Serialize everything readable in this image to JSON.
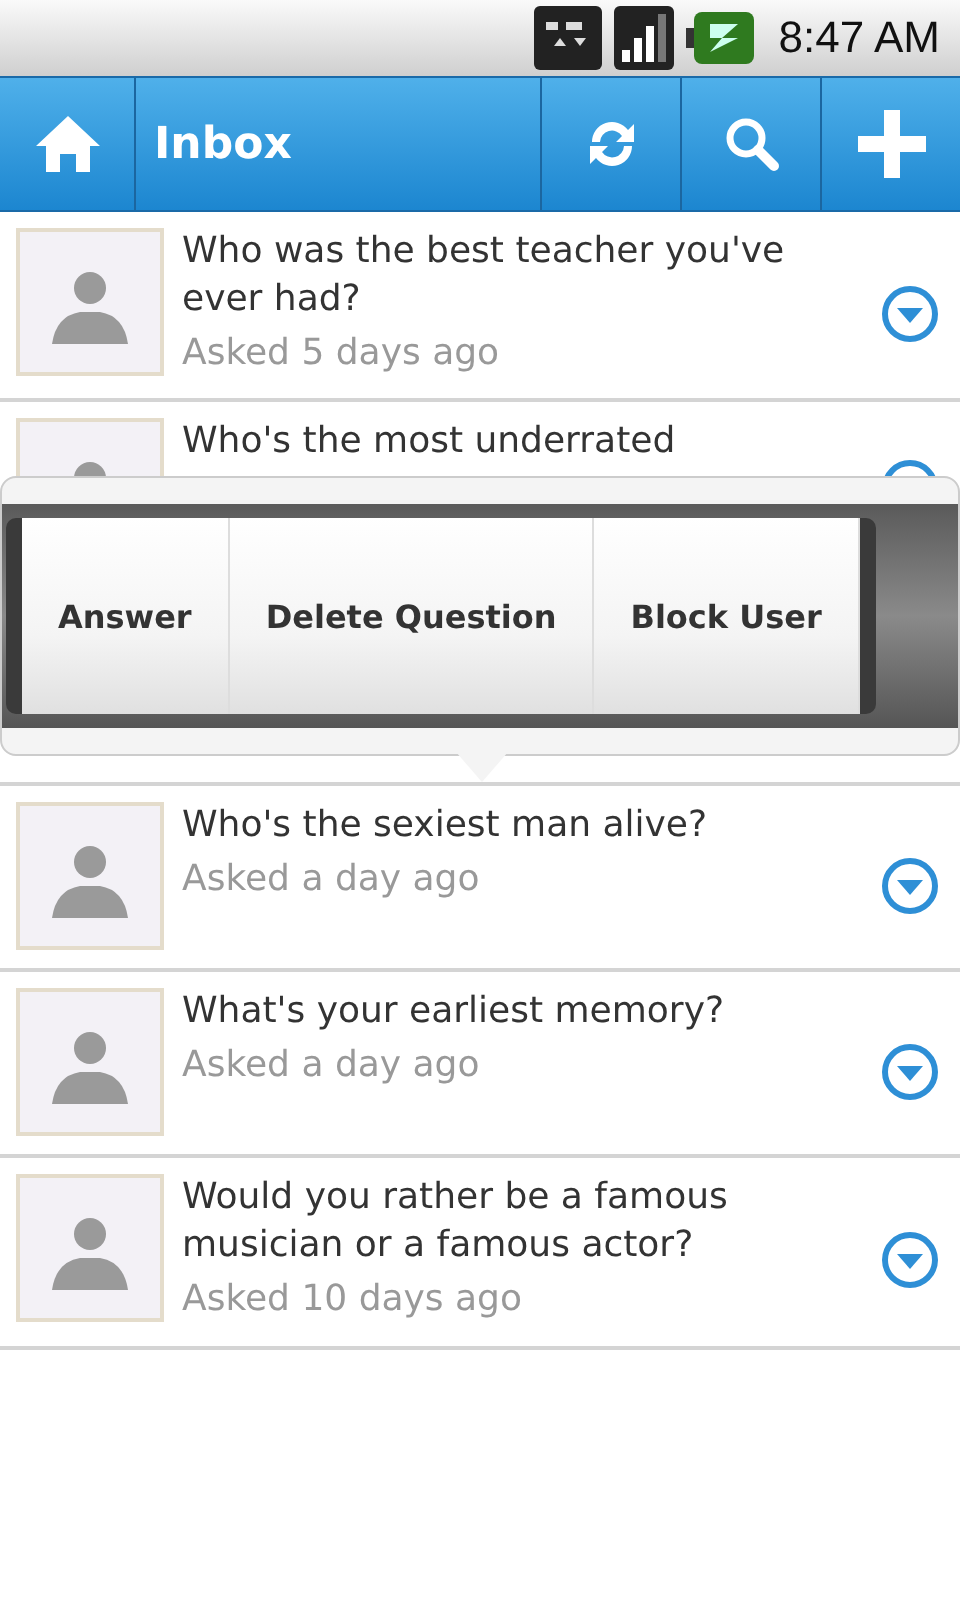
{
  "status_bar": {
    "time": "8:47 AM"
  },
  "action_bar": {
    "title": "Inbox"
  },
  "questions": [
    {
      "text": "Who was the best teacher you've ever had?",
      "meta": "Asked 5 days ago"
    },
    {
      "text": "Who's the most underrated",
      "quick_actions": [
        "Answer",
        "Delete Question",
        "Block User"
      ]
    },
    {
      "text": "Who's the sexiest man alive?",
      "meta": "Asked a day ago"
    },
    {
      "text": "What's your earliest memory?",
      "meta": "Asked a day ago"
    },
    {
      "text": "Would you rather be a famous musician or a famous actor?",
      "meta": "Asked 10 days ago"
    }
  ]
}
